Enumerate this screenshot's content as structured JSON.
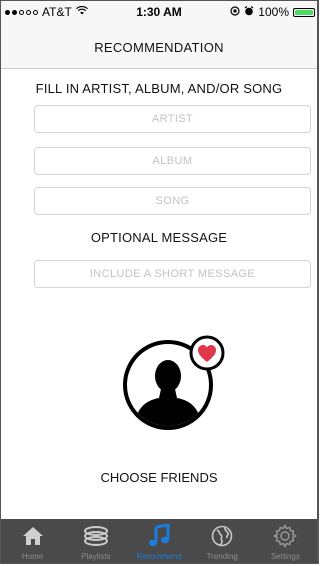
{
  "status_bar": {
    "carrier": "AT&T",
    "time": "1:30 AM",
    "battery": "100%"
  },
  "nav": {
    "title": "RECOMMENDATION"
  },
  "form": {
    "heading": "FILL IN ARTIST, ALBUM, AND/OR SONG",
    "artist_placeholder": "ARTIST",
    "album_placeholder": "ALBUM",
    "song_placeholder": "SONG",
    "message_heading": "OPTIONAL MESSAGE",
    "message_placeholder": "INCLUDE A SHORT MESSAGE"
  },
  "friends": {
    "label": "CHOOSE FRIENDS"
  },
  "tabs": [
    {
      "label": "Home",
      "icon": "home-icon"
    },
    {
      "label": "Playlists",
      "icon": "playlists-icon"
    },
    {
      "label": "Recommend",
      "icon": "music-note-icon",
      "active": true
    },
    {
      "label": "Trending",
      "icon": "globe-icon"
    },
    {
      "label": "Settings",
      "icon": "gear-icon"
    }
  ],
  "colors": {
    "accent": "#1a7de0",
    "heart": "#e0374c",
    "tabbar": "#4a4a4a",
    "battery": "#4cd964"
  }
}
